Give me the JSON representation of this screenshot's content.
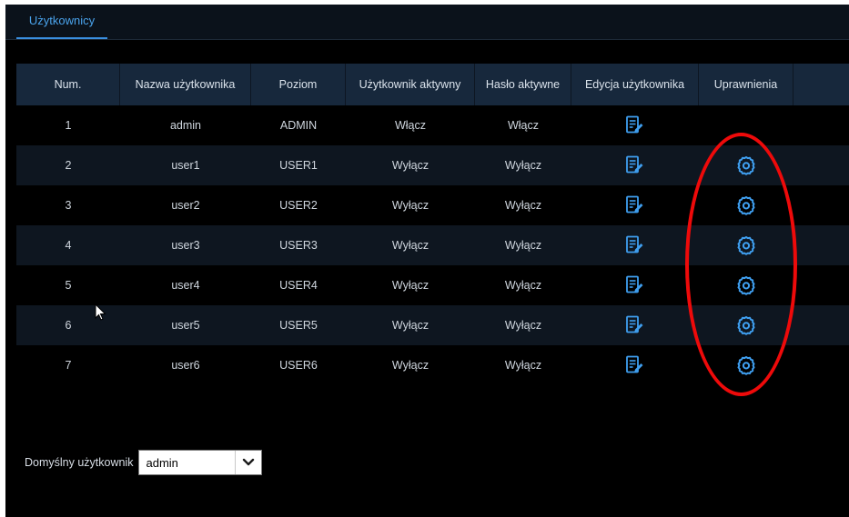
{
  "tabs": [
    {
      "label": "Użytkownicy",
      "active": true
    }
  ],
  "table": {
    "columns": [
      "Num.",
      "Nazwa użytkownika",
      "Poziom",
      "Użytkownik aktywny",
      "Hasło aktywne",
      "Edycja użytkownika",
      "Uprawnienia",
      ""
    ],
    "rows": [
      {
        "num": "1",
        "name": "admin",
        "level": "ADMIN",
        "user_active": "Włącz",
        "password_active": "Włącz",
        "edit_icon": "edit-icon",
        "permissions_icon": null
      },
      {
        "num": "2",
        "name": "user1",
        "level": "USER1",
        "user_active": "Wyłącz",
        "password_active": "Wyłącz",
        "edit_icon": "edit-icon",
        "permissions_icon": "gear-icon"
      },
      {
        "num": "3",
        "name": "user2",
        "level": "USER2",
        "user_active": "Wyłącz",
        "password_active": "Wyłącz",
        "edit_icon": "edit-icon",
        "permissions_icon": "gear-icon"
      },
      {
        "num": "4",
        "name": "user3",
        "level": "USER3",
        "user_active": "Wyłącz",
        "password_active": "Wyłącz",
        "edit_icon": "edit-icon",
        "permissions_icon": "gear-icon"
      },
      {
        "num": "5",
        "name": "user4",
        "level": "USER4",
        "user_active": "Wyłącz",
        "password_active": "Wyłącz",
        "edit_icon": "edit-icon",
        "permissions_icon": "gear-icon"
      },
      {
        "num": "6",
        "name": "user5",
        "level": "USER5",
        "user_active": "Wyłącz",
        "password_active": "Wyłącz",
        "edit_icon": "edit-icon",
        "permissions_icon": "gear-icon"
      },
      {
        "num": "7",
        "name": "user6",
        "level": "USER6",
        "user_active": "Wyłącz",
        "password_active": "Wyłącz",
        "edit_icon": "edit-icon",
        "permissions_icon": "gear-icon"
      }
    ]
  },
  "default_user": {
    "label": "Domyślny użytkownik",
    "value": "admin",
    "icon": "chevron-down-icon"
  },
  "colors": {
    "accent": "#3a8fe0",
    "header_bg": "#17283c",
    "annotation": "#ee0a0a"
  }
}
